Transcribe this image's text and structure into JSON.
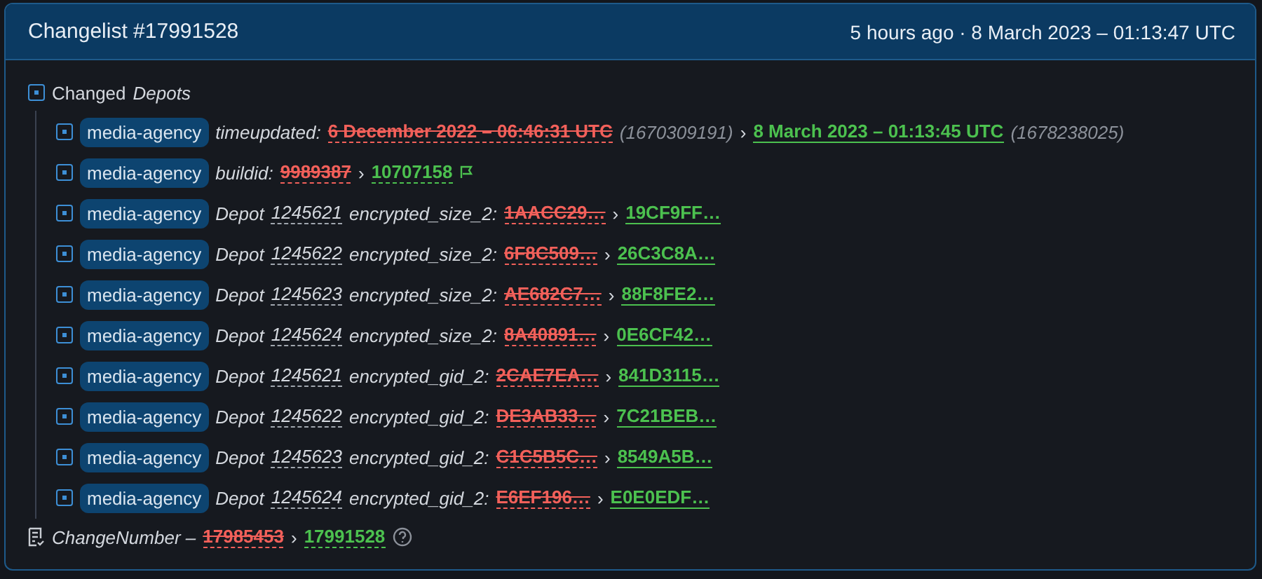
{
  "header": {
    "title": "Changelist #17991528",
    "time": "5 hours ago · 8 March 2023 – 01:13:47 UTC"
  },
  "section": {
    "label": "Changed",
    "label_em": "Depots"
  },
  "rows": [
    {
      "kind": "time",
      "tag": "media-agency",
      "key": "timeupdated:",
      "old": "6 December 2022 – 06:46:31 UTC",
      "old_raw": "(1670309191)",
      "arrow": "›",
      "new": "8 March 2023 – 01:13:45 UTC",
      "new_raw": "(1678238025)"
    },
    {
      "kind": "build",
      "tag": "media-agency",
      "key": "buildid:",
      "old": "9989387",
      "arrow": "›",
      "new": "10707158"
    },
    {
      "kind": "depot",
      "tag": "media-agency",
      "depot_label": "Depot",
      "depot": "1245621",
      "key": "encrypted_size_2:",
      "old": "1AACC29…",
      "arrow": "›",
      "new": "19CF9FF…"
    },
    {
      "kind": "depot",
      "tag": "media-agency",
      "depot_label": "Depot",
      "depot": "1245622",
      "key": "encrypted_size_2:",
      "old": "6F8C509…",
      "arrow": "›",
      "new": "26C3C8A…"
    },
    {
      "kind": "depot",
      "tag": "media-agency",
      "depot_label": "Depot",
      "depot": "1245623",
      "key": "encrypted_size_2:",
      "old": "AE682C7…",
      "arrow": "›",
      "new": "88F8FE2…"
    },
    {
      "kind": "depot",
      "tag": "media-agency",
      "depot_label": "Depot",
      "depot": "1245624",
      "key": "encrypted_size_2:",
      "old": "8A40891…",
      "arrow": "›",
      "new": "0E6CF42…"
    },
    {
      "kind": "depot",
      "tag": "media-agency",
      "depot_label": "Depot",
      "depot": "1245621",
      "key": "encrypted_gid_2:",
      "old": "2CAE7EA…",
      "arrow": "›",
      "new": "841D3115…"
    },
    {
      "kind": "depot",
      "tag": "media-agency",
      "depot_label": "Depot",
      "depot": "1245622",
      "key": "encrypted_gid_2:",
      "old": "DE3AB33…",
      "arrow": "›",
      "new": "7C21BEB…"
    },
    {
      "kind": "depot",
      "tag": "media-agency",
      "depot_label": "Depot",
      "depot": "1245623",
      "key": "encrypted_gid_2:",
      "old": "C1C5B5C…",
      "arrow": "›",
      "new": "8549A5B…"
    },
    {
      "kind": "depot",
      "tag": "media-agency",
      "depot_label": "Depot",
      "depot": "1245624",
      "key": "encrypted_gid_2:",
      "old": "E6EF196…",
      "arrow": "›",
      "new": "E0E0EDF…"
    }
  ],
  "footer": {
    "label": "ChangeNumber –",
    "old": "17985453",
    "arrow": "›",
    "new": "17991528"
  }
}
